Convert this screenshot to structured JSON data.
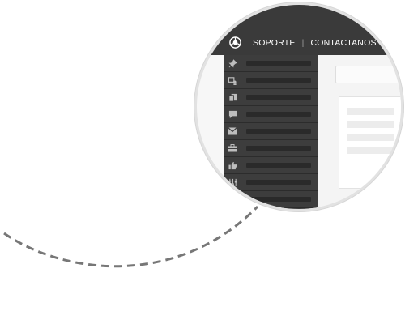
{
  "header": {
    "nav_support": "SOPORTE",
    "nav_separator": "|",
    "nav_contact": "CONTACTANOS"
  },
  "sidebar": {
    "items": [
      {
        "icon": "pin-icon"
      },
      {
        "icon": "user-card-icon"
      },
      {
        "icon": "pages-icon"
      },
      {
        "icon": "comment-icon"
      },
      {
        "icon": "mail-icon"
      },
      {
        "icon": "briefcase-icon"
      },
      {
        "icon": "thumbs-up-icon"
      },
      {
        "icon": "settings-icon"
      }
    ]
  },
  "colors": {
    "topbar": "#3a3a3a",
    "sidebar": "#3d3d3d",
    "icon": "#bdbdbd",
    "dash": "#777777"
  }
}
